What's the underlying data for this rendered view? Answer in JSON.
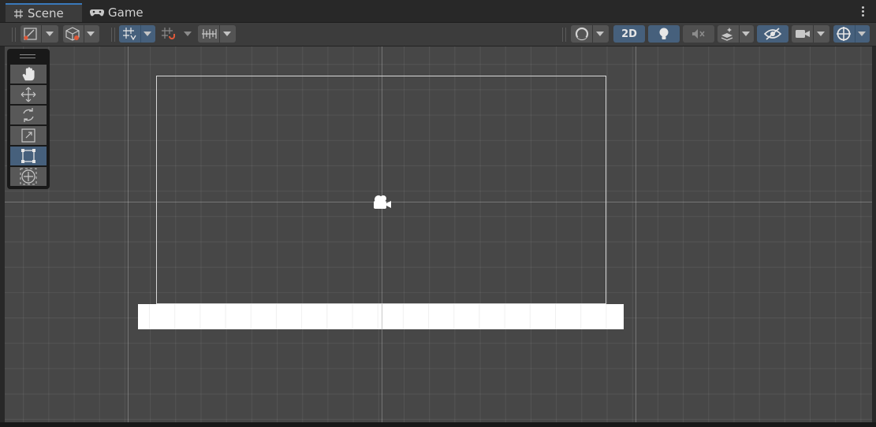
{
  "tabs": [
    {
      "label": "Scene",
      "icon": "grid-hash-icon",
      "active": true
    },
    {
      "label": "Game",
      "icon": "gamepad-icon",
      "active": false
    }
  ],
  "toolbar": {
    "view_2d_label": "2D",
    "accent_color": "#46607c",
    "buttons": [
      "tool-settings-icon",
      "component-tools-icon",
      "grid-snap-icon",
      "increment-snap-icon",
      "ruler-icon",
      "shading-mode-icon",
      "2d-toggle",
      "lighting-icon",
      "audio-mute-icon",
      "effects-icon",
      "visibility-icon",
      "camera-icon",
      "gizmos-icon"
    ]
  },
  "tools": [
    {
      "name": "hand-tool",
      "icon": "hand-icon",
      "active": false
    },
    {
      "name": "move-tool",
      "icon": "move-icon",
      "active": false
    },
    {
      "name": "rotate-tool",
      "icon": "rotate-icon",
      "active": false
    },
    {
      "name": "scale-tool",
      "icon": "scale-icon",
      "active": false
    },
    {
      "name": "rect-tool",
      "icon": "rect-icon",
      "active": true
    },
    {
      "name": "transform-tool",
      "icon": "transform-icon",
      "active": false
    }
  ],
  "scene": {
    "background": "#474747",
    "objects": [
      "main-camera-bounds",
      "ground-platform",
      "camera-gizmo"
    ]
  }
}
